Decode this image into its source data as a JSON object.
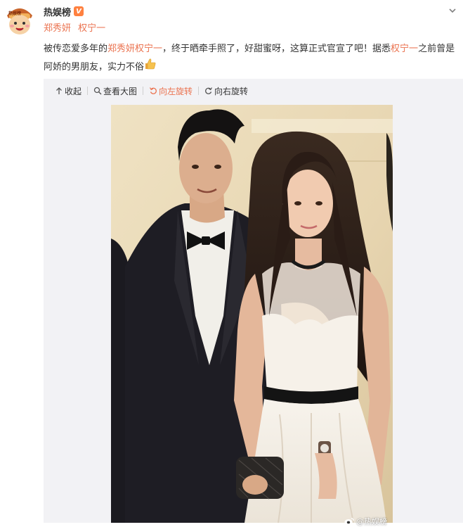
{
  "account": {
    "username": "热娱榜",
    "verified_badge": "V",
    "avatar_text": "热娱榜"
  },
  "tags": [
    "郑秀妍",
    "权宁一"
  ],
  "post": {
    "text_1": "被传恋爱多年的",
    "highlight_1": "郑秀妍权宁一",
    "text_2": "，终于晒牵手照了，好甜蜜呀，这算正式官宣了吧！据悉",
    "highlight_2": "权宁一",
    "text_3": "之前曾是阿娇的男朋友，实力不俗",
    "emoji": "thumbs-up-icon"
  },
  "toolbar": {
    "collapse_label": "收起",
    "view_large_label": "查看大图",
    "rotate_left_label": "向左旋转",
    "rotate_right_label": "向右旋转"
  },
  "photo": {
    "watermark": "@热娱榜"
  },
  "colors": {
    "link": "#eb7350",
    "verified": "#ff8140",
    "media_bg": "#f2f2f5"
  }
}
